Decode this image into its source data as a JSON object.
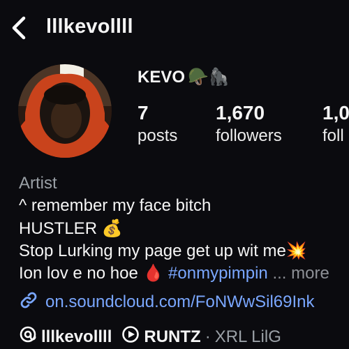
{
  "header": {
    "username": "lllkevollll"
  },
  "profile": {
    "display_name": "KEVO",
    "display_emojis": "🪖🦍",
    "stats": [
      {
        "value": "7",
        "label": "posts"
      },
      {
        "value": "1,670",
        "label": "followers"
      },
      {
        "value": "1,0",
        "label": "foll"
      }
    ]
  },
  "bio": {
    "category": "Artist",
    "lines": [
      "^ remember my face bitch",
      "HUSTLER 💰",
      "Stop Lurking my page get up wit me💥",
      "Ion lov e no hoe 🩸"
    ],
    "hashtag": "#onmypimpin",
    "more": "... more",
    "link": "on.soundcloud.com/FoNWwSil69Ink"
  },
  "badges": {
    "threads_handle": "lllkevollll",
    "music_title": "RUNTZ",
    "separator": "·",
    "music_artist": "XRL LilG"
  },
  "colors": {
    "background": "#0b0b0f",
    "link": "#7aa7ff",
    "muted": "#9aa0a6"
  }
}
